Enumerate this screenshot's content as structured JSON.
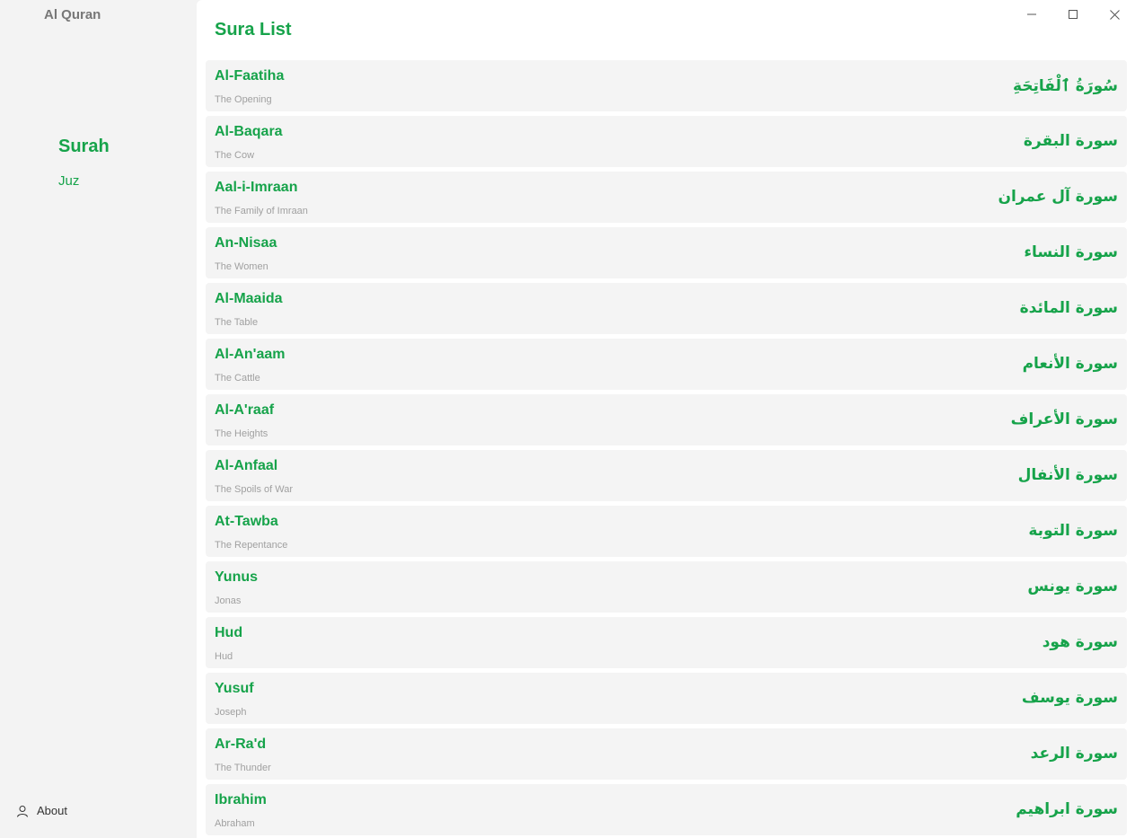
{
  "app": {
    "title": "Al Quran"
  },
  "sidebar": {
    "nav": [
      {
        "label": "Surah",
        "selected": true
      },
      {
        "label": "Juz",
        "selected": false
      }
    ],
    "about_label": "About"
  },
  "main": {
    "title": "Sura List"
  },
  "colors": {
    "accent": "#16a34a",
    "sidebar_bg": "#f3f3f3",
    "item_bg": "#f4f4f4",
    "meaning_text": "#a0a0a0"
  },
  "suras": [
    {
      "name": "Al-Faatiha",
      "meaning": "The Opening",
      "arabic": "سُورَةُ ٱلْفَاتِحَةِ"
    },
    {
      "name": "Al-Baqara",
      "meaning": "The Cow",
      "arabic": "سورة البقرة"
    },
    {
      "name": "Aal-i-Imraan",
      "meaning": "The Family of Imraan",
      "arabic": "سورة آل عمران"
    },
    {
      "name": "An-Nisaa",
      "meaning": "The Women",
      "arabic": "سورة النساء"
    },
    {
      "name": "Al-Maaida",
      "meaning": "The Table",
      "arabic": "سورة المائدة"
    },
    {
      "name": "Al-An'aam",
      "meaning": "The Cattle",
      "arabic": "سورة الأنعام"
    },
    {
      "name": "Al-A'raaf",
      "meaning": "The Heights",
      "arabic": "سورة الأعراف"
    },
    {
      "name": "Al-Anfaal",
      "meaning": "The Spoils of War",
      "arabic": "سورة الأنفال"
    },
    {
      "name": "At-Tawba",
      "meaning": "The Repentance",
      "arabic": "سورة التوبة"
    },
    {
      "name": "Yunus",
      "meaning": "Jonas",
      "arabic": "سورة يونس"
    },
    {
      "name": "Hud",
      "meaning": "Hud",
      "arabic": "سورة هود"
    },
    {
      "name": "Yusuf",
      "meaning": "Joseph",
      "arabic": "سورة يوسف"
    },
    {
      "name": "Ar-Ra'd",
      "meaning": "The Thunder",
      "arabic": "سورة الرعد"
    },
    {
      "name": "Ibrahim",
      "meaning": "Abraham",
      "arabic": "سورة ابراهيم"
    }
  ]
}
